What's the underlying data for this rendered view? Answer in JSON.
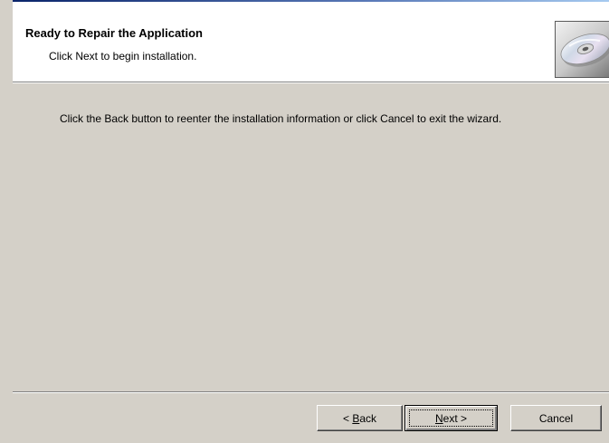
{
  "header": {
    "title": "Ready to Repair the Application",
    "subtitle": "Click Next to begin installation."
  },
  "content": {
    "message": "Click the Back button to reenter the installation information or click Cancel to exit the wizard."
  },
  "buttons": {
    "back": {
      "prefix": "< ",
      "mnemonic": "B",
      "rest": "ack"
    },
    "next": {
      "mnemonic": "N",
      "rest": "ext >"
    },
    "cancel": {
      "label": "Cancel"
    }
  },
  "icons": {
    "banner": "cd-disc-icon"
  }
}
